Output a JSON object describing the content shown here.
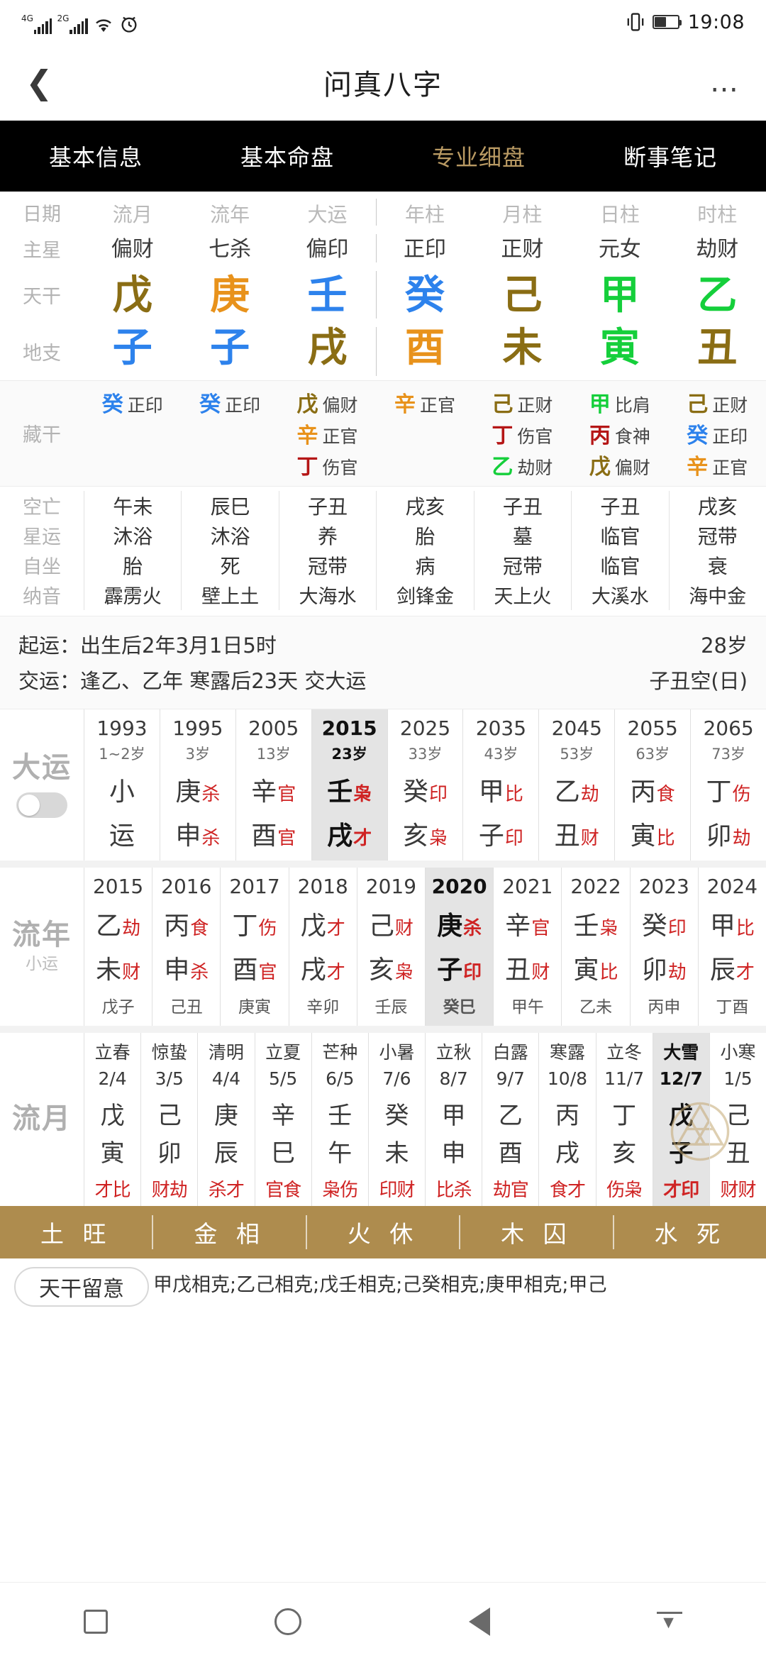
{
  "status_bar": {
    "net1": "4G",
    "net2": "2G",
    "icons": [
      "wifi-icon",
      "alarm-icon",
      "vibrate-icon",
      "battery-icon"
    ],
    "time": "19:08"
  },
  "nav": {
    "back_icon": "chevron-left-icon",
    "title": "问真八字",
    "more_icon": "ellipsis-icon"
  },
  "tabs": [
    {
      "label": "基本信息",
      "active": false
    },
    {
      "label": "基本命盘",
      "active": false
    },
    {
      "label": "专业细盘",
      "active": true
    },
    {
      "label": "断事笔记",
      "active": false
    }
  ],
  "colors": {
    "gold": "#8a6d14",
    "orange": "#e8921b",
    "blue": "#2d82ec",
    "green": "#15cf3b",
    "red": "#cf2323",
    "dark_red": "#b51616",
    "accent_bar": "#ae8c4e",
    "tab_gold": "#b99a63"
  },
  "chart_data": {
    "type": "table",
    "title": "问真八字 — 专业细盘",
    "row_labels": [
      "日期",
      "主星",
      "天干",
      "地支"
    ],
    "column_headers": [
      "流月",
      "流年",
      "大运",
      "年柱",
      "月柱",
      "日柱",
      "时柱"
    ],
    "main_stars": [
      "偏财",
      "七杀",
      "偏印",
      "正印",
      "正财",
      "元女",
      "劫财"
    ],
    "heavenly_stems": [
      {
        "char": "戊",
        "color": "#8a6d14"
      },
      {
        "char": "庚",
        "color": "#e8921b"
      },
      {
        "char": "壬",
        "color": "#2d82ec"
      },
      {
        "char": "癸",
        "color": "#2d82ec"
      },
      {
        "char": "己",
        "color": "#8a6d14"
      },
      {
        "char": "甲",
        "color": "#15cf3b"
      },
      {
        "char": "乙",
        "color": "#15cf3b"
      }
    ],
    "earthly_branches": [
      {
        "char": "子",
        "color": "#2d82ec"
      },
      {
        "char": "子",
        "color": "#2d82ec"
      },
      {
        "char": "戌",
        "color": "#8a6d14"
      },
      {
        "char": "酉",
        "color": "#e8921b"
      },
      {
        "char": "未",
        "color": "#8a6d14"
      },
      {
        "char": "寅",
        "color": "#15cf3b"
      },
      {
        "char": "丑",
        "color": "#8a6d14"
      }
    ]
  },
  "hidden_stems": {
    "label": "藏干",
    "columns": [
      [
        {
          "stem": "癸",
          "color": "#2d82ec",
          "god": "正印"
        }
      ],
      [
        {
          "stem": "癸",
          "color": "#2d82ec",
          "god": "正印"
        }
      ],
      [
        {
          "stem": "戊",
          "color": "#8a6d14",
          "god": "偏财"
        },
        {
          "stem": "辛",
          "color": "#e8921b",
          "god": "正官"
        },
        {
          "stem": "丁",
          "color": "#b51616",
          "god": "伤官"
        }
      ],
      [
        {
          "stem": "辛",
          "color": "#e8921b",
          "god": "正官"
        }
      ],
      [
        {
          "stem": "己",
          "color": "#8a6d14",
          "god": "正财"
        },
        {
          "stem": "丁",
          "color": "#b51616",
          "god": "伤官"
        },
        {
          "stem": "乙",
          "color": "#15cf3b",
          "god": "劫财"
        }
      ],
      [
        {
          "stem": "甲",
          "color": "#15cf3b",
          "god": "比肩"
        },
        {
          "stem": "丙",
          "color": "#b51616",
          "god": "食神"
        },
        {
          "stem": "戊",
          "color": "#8a6d14",
          "god": "偏财"
        }
      ],
      [
        {
          "stem": "己",
          "color": "#8a6d14",
          "god": "正财"
        },
        {
          "stem": "癸",
          "color": "#2d82ec",
          "god": "正印"
        },
        {
          "stem": "辛",
          "color": "#e8921b",
          "god": "正官"
        }
      ]
    ]
  },
  "fate_table": {
    "row_labels": [
      "空亡",
      "星运",
      "自坐",
      "纳音"
    ],
    "kongwang": [
      "午未",
      "辰巳",
      "子丑",
      "戌亥",
      "子丑",
      "子丑",
      "戌亥"
    ],
    "xingyun": [
      "沐浴",
      "沐浴",
      "养",
      "胎",
      "墓",
      "临官",
      "冠带"
    ],
    "zizuo": [
      "胎",
      "死",
      "冠带",
      "病",
      "冠带",
      "临官",
      "衰"
    ],
    "nayin": [
      "霹雳火",
      "壁上土",
      "大海水",
      "剑锋金",
      "天上火",
      "大溪水",
      "海中金"
    ]
  },
  "qiyun": {
    "line1_label": "起运：",
    "line1_value": "出生后2年3月1日5时",
    "line1_right": "28岁",
    "line2_label": "交运：",
    "line2_value": "逢乙、乙年 寒露后23天 交大运",
    "line2_right": "子丑空(日)"
  },
  "dayun": {
    "label": "大运",
    "toggle_name": "dayun-toggle",
    "columns": [
      {
        "year": "1993",
        "age": "1~2岁",
        "stem": "小",
        "stem_god": "",
        "branch": "运",
        "branch_god": "",
        "highlight": false
      },
      {
        "year": "1995",
        "age": "3岁",
        "stem": "庚",
        "stem_god": "杀",
        "branch": "申",
        "branch_god": "杀",
        "highlight": false
      },
      {
        "year": "2005",
        "age": "13岁",
        "stem": "辛",
        "stem_god": "官",
        "branch": "酉",
        "branch_god": "官",
        "highlight": false
      },
      {
        "year": "2015",
        "age": "23岁",
        "stem": "壬",
        "stem_god": "枭",
        "branch": "戌",
        "branch_god": "才",
        "highlight": true
      },
      {
        "year": "2025",
        "age": "33岁",
        "stem": "癸",
        "stem_god": "印",
        "branch": "亥",
        "branch_god": "枭",
        "highlight": false
      },
      {
        "year": "2035",
        "age": "43岁",
        "stem": "甲",
        "stem_god": "比",
        "branch": "子",
        "branch_god": "印",
        "highlight": false
      },
      {
        "year": "2045",
        "age": "53岁",
        "stem": "乙",
        "stem_god": "劫",
        "branch": "丑",
        "branch_god": "财",
        "highlight": false
      },
      {
        "year": "2055",
        "age": "63岁",
        "stem": "丙",
        "stem_god": "食",
        "branch": "寅",
        "branch_god": "比",
        "highlight": false
      },
      {
        "year": "2065",
        "age": "73岁",
        "stem": "丁",
        "stem_god": "伤",
        "branch": "卯",
        "branch_god": "劫",
        "highlight": false
      }
    ]
  },
  "liunian": {
    "label": "流年",
    "sublabel": "小运",
    "columns": [
      {
        "year": "2015",
        "stem": "乙",
        "stem_god": "劫",
        "branch": "未",
        "branch_god": "财",
        "xiaoyun": "戊子",
        "highlight": false
      },
      {
        "year": "2016",
        "stem": "丙",
        "stem_god": "食",
        "branch": "申",
        "branch_god": "杀",
        "xiaoyun": "己丑",
        "highlight": false
      },
      {
        "year": "2017",
        "stem": "丁",
        "stem_god": "伤",
        "branch": "酉",
        "branch_god": "官",
        "xiaoyun": "庚寅",
        "highlight": false
      },
      {
        "year": "2018",
        "stem": "戊",
        "stem_god": "才",
        "branch": "戌",
        "branch_god": "才",
        "xiaoyun": "辛卯",
        "highlight": false
      },
      {
        "year": "2019",
        "stem": "己",
        "stem_god": "财",
        "branch": "亥",
        "branch_god": "枭",
        "xiaoyun": "壬辰",
        "highlight": false
      },
      {
        "year": "2020",
        "stem": "庚",
        "stem_god": "杀",
        "branch": "子",
        "branch_god": "印",
        "xiaoyun": "癸巳",
        "highlight": true
      },
      {
        "year": "2021",
        "stem": "辛",
        "stem_god": "官",
        "branch": "丑",
        "branch_god": "财",
        "xiaoyun": "甲午",
        "highlight": false
      },
      {
        "year": "2022",
        "stem": "壬",
        "stem_god": "枭",
        "branch": "寅",
        "branch_god": "比",
        "xiaoyun": "乙未",
        "highlight": false
      },
      {
        "year": "2023",
        "stem": "癸",
        "stem_god": "印",
        "branch": "卯",
        "branch_god": "劫",
        "xiaoyun": "丙申",
        "highlight": false
      },
      {
        "year": "2024",
        "stem": "甲",
        "stem_god": "比",
        "branch": "辰",
        "branch_god": "才",
        "xiaoyun": "丁酉",
        "highlight": false
      }
    ]
  },
  "liuyue": {
    "label": "流月",
    "columns": [
      {
        "jieqi": "立春",
        "date": "2/4",
        "stem": "戊",
        "branch": "寅",
        "gods": "才比",
        "highlight": false
      },
      {
        "jieqi": "惊蛰",
        "date": "3/5",
        "stem": "己",
        "branch": "卯",
        "gods": "财劫",
        "highlight": false
      },
      {
        "jieqi": "清明",
        "date": "4/4",
        "stem": "庚",
        "branch": "辰",
        "gods": "杀才",
        "highlight": false
      },
      {
        "jieqi": "立夏",
        "date": "5/5",
        "stem": "辛",
        "branch": "巳",
        "gods": "官食",
        "highlight": false
      },
      {
        "jieqi": "芒种",
        "date": "6/5",
        "stem": "壬",
        "branch": "午",
        "gods": "枭伤",
        "highlight": false
      },
      {
        "jieqi": "小暑",
        "date": "7/6",
        "stem": "癸",
        "branch": "未",
        "gods": "印财",
        "highlight": false
      },
      {
        "jieqi": "立秋",
        "date": "8/7",
        "stem": "甲",
        "branch": "申",
        "gods": "比杀",
        "highlight": false
      },
      {
        "jieqi": "白露",
        "date": "9/7",
        "stem": "乙",
        "branch": "酉",
        "gods": "劫官",
        "highlight": false
      },
      {
        "jieqi": "寒露",
        "date": "10/8",
        "stem": "丙",
        "branch": "戌",
        "gods": "食才",
        "highlight": false
      },
      {
        "jieqi": "立冬",
        "date": "11/7",
        "stem": "丁",
        "branch": "亥",
        "gods": "伤枭",
        "highlight": false
      },
      {
        "jieqi": "大雪",
        "date": "12/7",
        "stem": "戊",
        "branch": "子",
        "gods": "才印",
        "highlight": true
      },
      {
        "jieqi": "小寒",
        "date": "1/5",
        "stem": "己",
        "branch": "丑",
        "gods": "财财",
        "highlight": false
      }
    ]
  },
  "wuxing": [
    {
      "element": "土",
      "state": "旺"
    },
    {
      "element": "金",
      "state": "相"
    },
    {
      "element": "火",
      "state": "休"
    },
    {
      "element": "木",
      "state": "囚"
    },
    {
      "element": "水",
      "state": "死"
    }
  ],
  "note": {
    "pill": "天干留意",
    "text": "甲戊相克;乙己相克;戊壬相克;己癸相克;庚甲相克;甲己"
  },
  "android_nav": {
    "recent_icon": "square-icon",
    "home_icon": "circle-icon",
    "back_icon": "triangle-back-icon",
    "download_icon": "download-icon"
  }
}
